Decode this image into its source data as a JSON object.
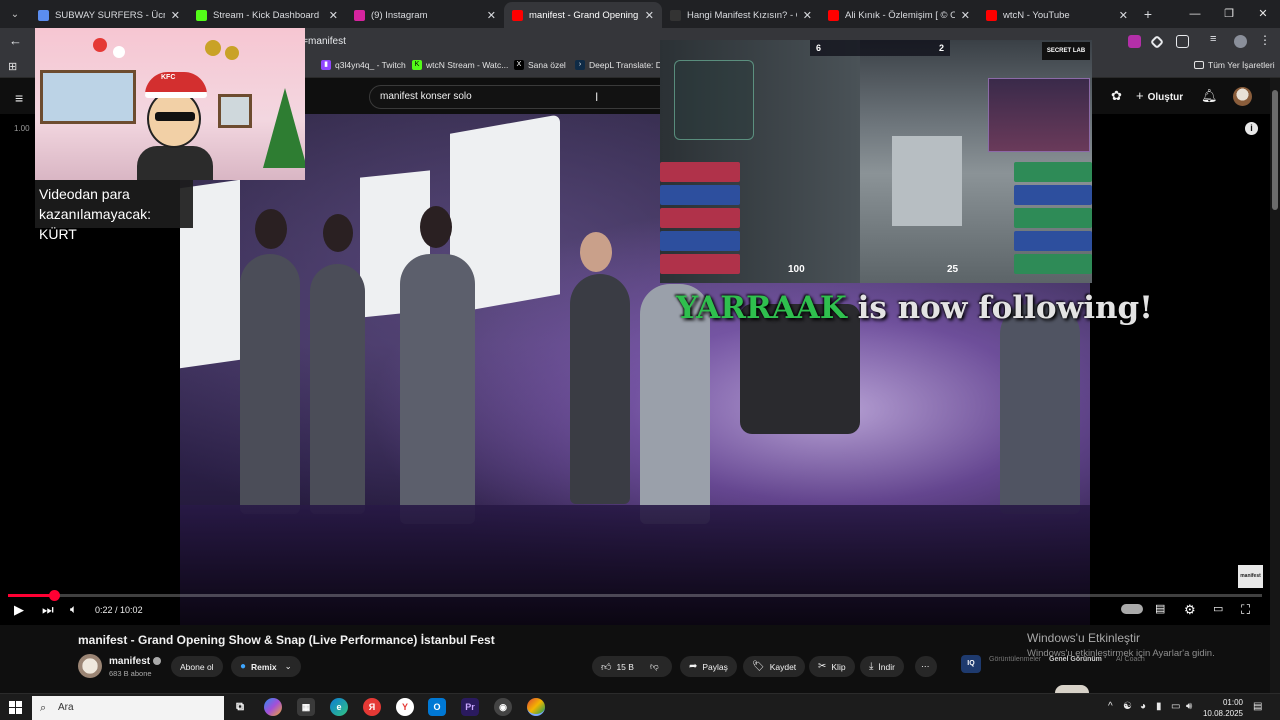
{
  "browser": {
    "tabs": [
      {
        "title": "SUBWAY SURFERS - Ücretsiz Ç",
        "icon": "globe-icon",
        "color": "#5b8def",
        "active": false
      },
      {
        "title": "Stream - Kick Dashboard",
        "icon": "kick-icon",
        "color": "#53fc18",
        "active": false
      },
      {
        "title": "(9) Instagram",
        "icon": "instagram-icon",
        "color": "#d6249f",
        "active": false
      },
      {
        "title": "manifest - Grand Opening S",
        "icon": "youtube-icon",
        "color": "#ff0000",
        "active": true
      },
      {
        "title": "Hangi Manifest Kızısın? - Oned",
        "icon": "onedio-icon",
        "color": "#333333",
        "active": false
      },
      {
        "title": "Ali Kınık - Özlemişim [ © Officia",
        "icon": "youtube-icon",
        "color": "#ff0000",
        "active": false
      },
      {
        "title": "wtcN - YouTube",
        "icon": "youtube-icon",
        "color": "#ff0000",
        "active": false
      }
    ],
    "address_fragment": "l=manifest",
    "bookmarks": [
      {
        "label": "q3l4yn4q_ - Twitch",
        "icon": "twitch-icon",
        "color": "#9146ff"
      },
      {
        "label": "wtcN Stream - Watc...",
        "icon": "kick-icon",
        "color": "#53fc18"
      },
      {
        "label": "Sana özel",
        "icon": "x-icon",
        "color": "#000000"
      },
      {
        "label": "DeepL Translate: Dü...",
        "icon": "deepl-icon",
        "color": "#0f2b46"
      }
    ],
    "all_bookmarks": "Tüm Yer İşaretleri"
  },
  "youtube": {
    "search_value": "manifest konser solo",
    "create_label": "Oluştur",
    "side_number": "1.00"
  },
  "overlays": {
    "monetization_text": "Videodan para kazanılamayacak: KÜRT",
    "follow_name": "YARRAAK",
    "follow_rest": " is now following!",
    "game": {
      "score_left": "6",
      "score_right": "2",
      "health": "100",
      "ammo": "25",
      "team_logo": "SECRET LAB"
    },
    "cam_label": "KFC"
  },
  "player": {
    "time_current": "0:22",
    "time_total": "10:02",
    "progress_fraction": 0.0365,
    "watermark": "manifest"
  },
  "video": {
    "title": "manifest - Grand Opening Show & Snap (Live Performance) İstanbul Fest",
    "channel": "manifest",
    "subscribers": "683 B abone",
    "subscribe_label": "Abone ol",
    "remix_label": "Remix",
    "likes": "15 B",
    "share_label": "Paylaş",
    "save_label": "Kaydet",
    "clip_label": "Klip",
    "download_label": "İndir"
  },
  "watermark_windows": {
    "line1": "Windows'u Etkinleştir",
    "line2": "Windows'u etkinleştirmek için Ayarlar'a gidin."
  },
  "side_tabs": [
    "Görüntülenmeler",
    "Genel Görünüm",
    "AI Coach"
  ],
  "taskbar": {
    "search_placeholder": "Ara",
    "time": "01:00",
    "date": "10.08.2025"
  }
}
